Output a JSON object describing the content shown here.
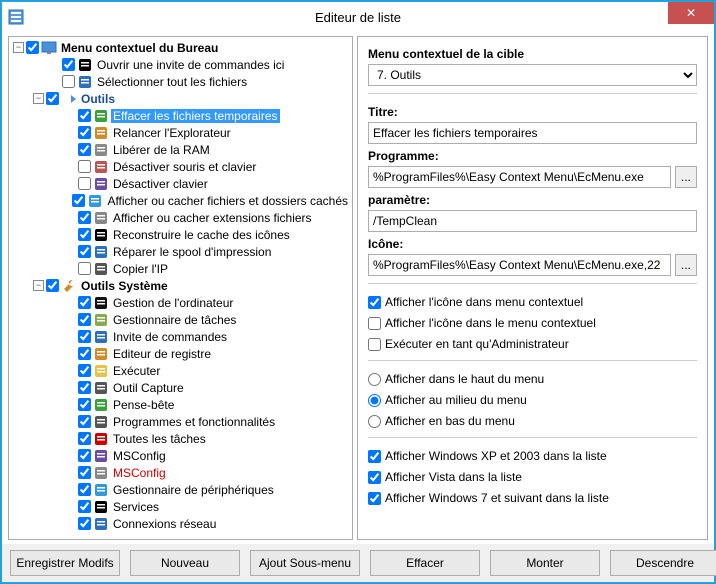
{
  "window": {
    "title": "Editeur de liste",
    "close_glyph": "✕"
  },
  "tree": {
    "root": {
      "label": "Menu contextuel du Bureau"
    },
    "desktop_items": [
      {
        "label": "Ouvrir une invite de commandes ici",
        "checked": true
      },
      {
        "label": "Sélectionner tout les fichiers",
        "checked": false
      }
    ],
    "tools_header": {
      "label": "Outils"
    },
    "tools_items": [
      {
        "label": "Effacer les fichiers temporaires",
        "checked": true,
        "selected": true
      },
      {
        "label": "Relancer l'Explorateur",
        "checked": true
      },
      {
        "label": "Libérer de la RAM",
        "checked": true
      },
      {
        "label": "Désactiver souris et clavier",
        "checked": false
      },
      {
        "label": "Désactiver clavier",
        "checked": false
      },
      {
        "label": "Afficher ou cacher fichiers et dossiers cachés",
        "checked": true
      },
      {
        "label": "Afficher ou cacher extensions fichiers",
        "checked": true
      },
      {
        "label": "Reconstruire le cache des icônes",
        "checked": true
      },
      {
        "label": "Réparer le spool d'impression",
        "checked": true
      },
      {
        "label": "Copier l'IP",
        "checked": false
      }
    ],
    "systools_header": {
      "label": "Outils Système"
    },
    "systools_items": [
      {
        "label": "Gestion de l'ordinateur",
        "checked": true
      },
      {
        "label": "Gestionnaire de tâches",
        "checked": true
      },
      {
        "label": "Invite de commandes",
        "checked": true
      },
      {
        "label": "Editeur de registre",
        "checked": true
      },
      {
        "label": "Exécuter",
        "checked": true
      },
      {
        "label": "Outil Capture",
        "checked": true
      },
      {
        "label": "Pense-bête",
        "checked": true
      },
      {
        "label": "Programmes et fonctionnalités",
        "checked": true
      },
      {
        "label": "Toutes les tâches",
        "checked": true
      },
      {
        "label": "MSConfig",
        "checked": true
      },
      {
        "label": "MSConfig",
        "checked": true,
        "red": true
      },
      {
        "label": "Gestionnaire de périphériques",
        "checked": true
      },
      {
        "label": "Services",
        "checked": true
      },
      {
        "label": "Connexions réseau",
        "checked": true
      }
    ]
  },
  "panel": {
    "target_label": "Menu contextuel de la cible",
    "target_value": "7. Outils",
    "title_label": "Titre:",
    "title_value": "Effacer les fichiers temporaires",
    "program_label": "Programme:",
    "program_value": "%ProgramFiles%\\Easy Context Menu\\EcMenu.exe",
    "param_label": "paramètre:",
    "param_value": "/TempClean",
    "icon_label": "Icône:",
    "icon_value": "%ProgramFiles%\\Easy Context Menu\\EcMenu.exe,22",
    "browse": "...",
    "chk_show_ctx": "Afficher l'icône dans menu contextuel",
    "chk_show_in_ctx": "Afficher l'icône dans le menu contextuel",
    "chk_run_admin": "Exécuter en tant qu'Administrateur",
    "rad_top": "Afficher dans le haut du menu",
    "rad_mid": "Afficher au milieu du menu",
    "rad_bot": "Afficher en bas du menu",
    "chk_xp": "Afficher Windows XP et 2003 dans la liste",
    "chk_vista": "Afficher Vista dans la liste",
    "chk_win7": "Afficher Windows 7 et suivant dans la liste"
  },
  "footer": {
    "save": "Enregistrer Modifs",
    "new": "Nouveau",
    "addsub": "Ajout Sous-menu",
    "clear": "Effacer",
    "up": "Monter",
    "down": "Descendre"
  },
  "icon_colors": [
    "#000000",
    "#2c6fbb",
    "#3aa03a",
    "#d18b2a",
    "#888888",
    "#b55",
    "#6a4ca0",
    "#3498db",
    "#888",
    "#000",
    "#2c6fbb",
    "#555",
    "#111",
    "#8a5",
    "#2c6fbb",
    "#d18b2a",
    "#e6c34b",
    "#555",
    "#3aa03a",
    "#555",
    "#c00",
    "#6a4ca0",
    "#888",
    "#3498db"
  ]
}
